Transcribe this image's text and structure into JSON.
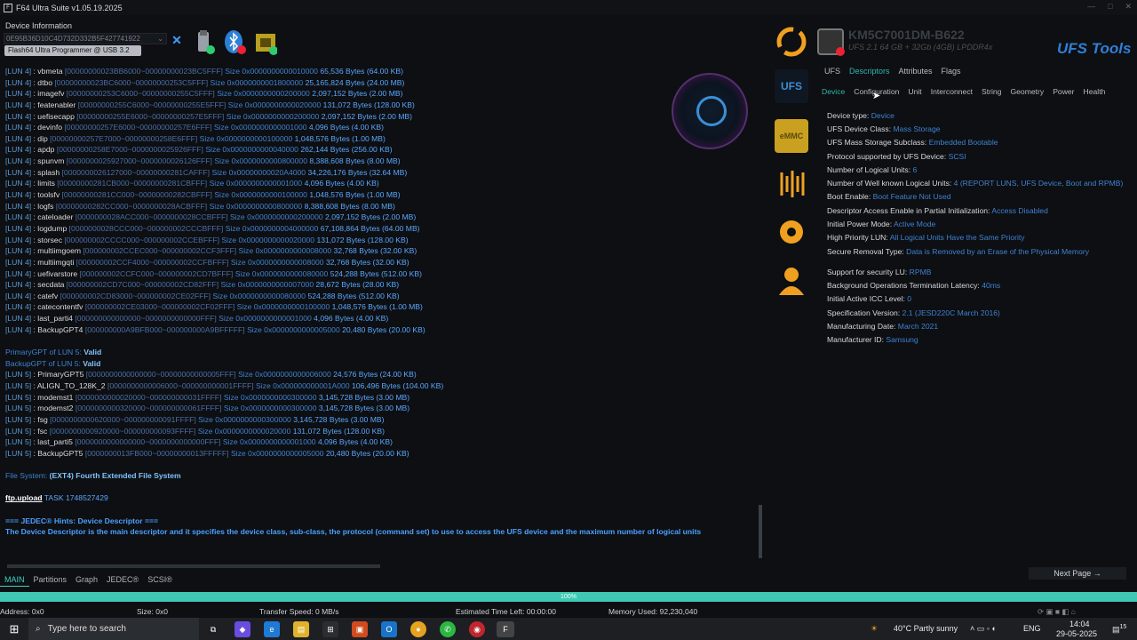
{
  "title": "F64 Ultra Suite v1.05.19.2025",
  "device_info_label": "Device Information",
  "serial": "0E95B36D10C4D732D332B5F427741922",
  "programmer": "Flash64 Ultra Programmer @ USB 3.2",
  "log_lines": [
    [
      [
        "lun",
        "[LUN 4]"
      ],
      [
        "nm",
        " : vbmeta "
      ],
      [
        "rng",
        "[00000000023BB6000~00000000023BC5FFF] "
      ],
      [
        "sz",
        "Size 0x0000000000010000 "
      ],
      [
        "by",
        "65,536 Bytes (64.00 KB)"
      ]
    ],
    [
      [
        "lun",
        "[LUN 4]"
      ],
      [
        "nm",
        " : dtbo "
      ],
      [
        "rng",
        "[00000000023BC6000~00000000253C5FFF] "
      ],
      [
        "sz",
        "Size 0x0000000001800000 "
      ],
      [
        "by",
        "25,165,824 Bytes (24.00 MB)"
      ]
    ],
    [
      [
        "lun",
        "[LUN 4]"
      ],
      [
        "nm",
        " : imagefv "
      ],
      [
        "rng",
        "[00000000253C6000~00000000255C5FFF] "
      ],
      [
        "sz",
        "Size 0x0000000000200000 "
      ],
      [
        "by",
        "2,097,152 Bytes (2.00 MB)"
      ]
    ],
    [
      [
        "lun",
        "[LUN 4]"
      ],
      [
        "nm",
        " : featenabler "
      ],
      [
        "rng",
        "[00000000255C6000~00000000255E5FFF] "
      ],
      [
        "sz",
        "Size 0x0000000000020000 "
      ],
      [
        "by",
        "131,072 Bytes (128.00 KB)"
      ]
    ],
    [
      [
        "lun",
        "[LUN 4]"
      ],
      [
        "nm",
        " : uefisecapp "
      ],
      [
        "rng",
        "[00000000255E6000~00000000257E5FFF] "
      ],
      [
        "sz",
        "Size 0x0000000000200000 "
      ],
      [
        "by",
        "2,097,152 Bytes (2.00 MB)"
      ]
    ],
    [
      [
        "lun",
        "[LUN 4]"
      ],
      [
        "nm",
        " : devinfo "
      ],
      [
        "rng",
        "[00000000257E6000~00000000257E6FFF] "
      ],
      [
        "sz",
        "Size 0x0000000000001000 "
      ],
      [
        "by",
        "4,096 Bytes (4.00 KB)"
      ]
    ],
    [
      [
        "lun",
        "[LUN 4]"
      ],
      [
        "nm",
        " : dip "
      ],
      [
        "rng",
        "[00000000257E7000~00000000258E6FFF] "
      ],
      [
        "sz",
        "Size 0x0000000000100000 "
      ],
      [
        "by",
        "1,048,576 Bytes (1.00 MB)"
      ]
    ],
    [
      [
        "lun",
        "[LUN 4]"
      ],
      [
        "nm",
        " : apdp "
      ],
      [
        "rng",
        "[00000000258E7000~0000000025926FFF] "
      ],
      [
        "sz",
        "Size 0x0000000000040000 "
      ],
      [
        "by",
        "262,144 Bytes (256.00 KB)"
      ]
    ],
    [
      [
        "lun",
        "[LUN 4]"
      ],
      [
        "nm",
        " : spunvm "
      ],
      [
        "rng",
        "[0000000025927000~0000000026126FFF] "
      ],
      [
        "sz",
        "Size 0x0000000000800000 "
      ],
      [
        "by",
        "8,388,608 Bytes (8.00 MB)"
      ]
    ],
    [
      [
        "lun",
        "[LUN 4]"
      ],
      [
        "nm",
        " : splash "
      ],
      [
        "rng",
        "[0000000026127000~00000000281CAFFF] "
      ],
      [
        "sz",
        "Size 0x00000000020A4000 "
      ],
      [
        "by",
        "34,226,176 Bytes (32.64 MB)"
      ]
    ],
    [
      [
        "lun",
        "[LUN 4]"
      ],
      [
        "nm",
        " : limits "
      ],
      [
        "rng",
        "[00000000281CB000~00000000281CBFFF] "
      ],
      [
        "sz",
        "Size 0x0000000000001000 "
      ],
      [
        "by",
        "4,096 Bytes (4.00 KB)"
      ]
    ],
    [
      [
        "lun",
        "[LUN 4]"
      ],
      [
        "nm",
        " : toolsfv "
      ],
      [
        "rng",
        "[00000000281CC000~00000000282CBFFF] "
      ],
      [
        "sz",
        "Size 0x0000000000100000 "
      ],
      [
        "by",
        "1,048,576 Bytes (1.00 MB)"
      ]
    ],
    [
      [
        "lun",
        "[LUN 4]"
      ],
      [
        "nm",
        " : logfs "
      ],
      [
        "rng",
        "[00000000282CC000~0000000028ACBFFF] "
      ],
      [
        "sz",
        "Size 0x0000000000800000 "
      ],
      [
        "by",
        "8,388,608 Bytes (8.00 MB)"
      ]
    ],
    [
      [
        "lun",
        "[LUN 4]"
      ],
      [
        "nm",
        " : cateloader "
      ],
      [
        "rng",
        "[0000000028ACC000~0000000028CCBFFF] "
      ],
      [
        "sz",
        "Size 0x0000000000200000 "
      ],
      [
        "by",
        "2,097,152 Bytes (2.00 MB)"
      ]
    ],
    [
      [
        "lun",
        "[LUN 4]"
      ],
      [
        "nm",
        " : logdump "
      ],
      [
        "rng",
        "[0000000028CCC000~000000002CCCBFFF] "
      ],
      [
        "sz",
        "Size 0x0000000004000000 "
      ],
      [
        "by",
        "67,108,864 Bytes (64.00 MB)"
      ]
    ],
    [
      [
        "lun",
        "[LUN 4]"
      ],
      [
        "nm",
        " : storsec "
      ],
      [
        "rng",
        "[000000002CCCC000~000000002CCEBFFF] "
      ],
      [
        "sz",
        "Size 0x0000000000020000 "
      ],
      [
        "by",
        "131,072 Bytes (128.00 KB)"
      ]
    ],
    [
      [
        "lun",
        "[LUN 4]"
      ],
      [
        "nm",
        " : multiimgoem "
      ],
      [
        "rng",
        "[000000002CCEC000~000000002CCF3FFF] "
      ],
      [
        "sz",
        "Size 0x0000000000008000 "
      ],
      [
        "by",
        "32,768 Bytes (32.00 KB)"
      ]
    ],
    [
      [
        "lun",
        "[LUN 4]"
      ],
      [
        "nm",
        " : multiimgqti "
      ],
      [
        "rng",
        "[000000002CCF4000~000000002CCFBFFF] "
      ],
      [
        "sz",
        "Size 0x0000000000008000 "
      ],
      [
        "by",
        "32,768 Bytes (32.00 KB)"
      ]
    ],
    [
      [
        "lun",
        "[LUN 4]"
      ],
      [
        "nm",
        " : uefivarstore "
      ],
      [
        "rng",
        "[000000002CCFC000~000000002CD7BFFF] "
      ],
      [
        "sz",
        "Size 0x0000000000080000 "
      ],
      [
        "by",
        "524,288 Bytes (512.00 KB)"
      ]
    ],
    [
      [
        "lun",
        "[LUN 4]"
      ],
      [
        "nm",
        " : secdata "
      ],
      [
        "rng",
        "[000000002CD7C000~000000002CD82FFF] "
      ],
      [
        "sz",
        "Size 0x0000000000007000 "
      ],
      [
        "by",
        "28,672 Bytes (28.00 KB)"
      ]
    ],
    [
      [
        "lun",
        "[LUN 4]"
      ],
      [
        "nm",
        " : catefv "
      ],
      [
        "rng",
        "[000000002CD83000~000000002CE02FFF] "
      ],
      [
        "sz",
        "Size 0x0000000000080000 "
      ],
      [
        "by",
        "524,288 Bytes (512.00 KB)"
      ]
    ],
    [
      [
        "lun",
        "[LUN 4]"
      ],
      [
        "nm",
        " : catecontentfv "
      ],
      [
        "rng",
        "[000000002CE03000~000000002CF02FFF] "
      ],
      [
        "sz",
        "Size 0x0000000000100000 "
      ],
      [
        "by",
        "1,048,576 Bytes (1.00 MB)"
      ]
    ],
    [
      [
        "lun",
        "[LUN 4]"
      ],
      [
        "nm",
        " : last_parti4 "
      ],
      [
        "rng",
        "[000000000000000~0000000000000FFF] "
      ],
      [
        "sz",
        "Size 0x0000000000001000 "
      ],
      [
        "by",
        "4,096 Bytes (4.00 KB)"
      ]
    ],
    [
      [
        "lun",
        "[LUN 4]"
      ],
      [
        "nm",
        " : BackupGPT4 "
      ],
      [
        "rng",
        "[000000000A9BFB000~000000000A9BFFFFF] "
      ],
      [
        "sz",
        "Size 0x0000000000005000 "
      ],
      [
        "by",
        "20,480 Bytes (20.00 KB)"
      ]
    ],
    [],
    [
      [
        "gpt",
        "PrimaryGPT of LUN 5: "
      ],
      [
        "valid",
        "Valid"
      ]
    ],
    [
      [
        "gpt",
        "BackupGPT of LUN 5: "
      ],
      [
        "valid",
        "Valid"
      ]
    ],
    [
      [
        "lun",
        "[LUN 5]"
      ],
      [
        "nm",
        " : PrimaryGPT5 "
      ],
      [
        "rng",
        "[0000000000000000~00000000000005FFF] "
      ],
      [
        "sz",
        "Size 0x0000000000006000 "
      ],
      [
        "by",
        "24,576 Bytes (24.00 KB)"
      ]
    ],
    [
      [
        "lun",
        "[LUN 5]"
      ],
      [
        "nm",
        " : ALIGN_TO_128K_2 "
      ],
      [
        "rng",
        "[0000000000006000~000000000001FFFF] "
      ],
      [
        "sz",
        "Size 0x000000000001A000 "
      ],
      [
        "by",
        "106,496 Bytes (104.00 KB)"
      ]
    ],
    [
      [
        "lun",
        "[LUN 5]"
      ],
      [
        "nm",
        " : modemst1 "
      ],
      [
        "rng",
        "[0000000000020000~000000000031FFFF] "
      ],
      [
        "sz",
        "Size 0x0000000000300000 "
      ],
      [
        "by",
        "3,145,728 Bytes (3.00 MB)"
      ]
    ],
    [
      [
        "lun",
        "[LUN 5]"
      ],
      [
        "nm",
        " : modemst2 "
      ],
      [
        "rng",
        "[0000000000320000~000000000061FFFF] "
      ],
      [
        "sz",
        "Size 0x0000000000300000 "
      ],
      [
        "by",
        "3,145,728 Bytes (3.00 MB)"
      ]
    ],
    [
      [
        "lun",
        "[LUN 5]"
      ],
      [
        "nm",
        " : fsg "
      ],
      [
        "rng",
        "[0000000000620000~000000000091FFFF] "
      ],
      [
        "sz",
        "Size 0x0000000000300000 "
      ],
      [
        "by",
        "3,145,728 Bytes (3.00 MB)"
      ]
    ],
    [
      [
        "lun",
        "[LUN 5]"
      ],
      [
        "nm",
        " : fsc "
      ],
      [
        "rng",
        "[0000000000920000~000000000093FFFF] "
      ],
      [
        "sz",
        "Size 0x0000000000020000 "
      ],
      [
        "by",
        "131,072 Bytes (128.00 KB)"
      ]
    ],
    [
      [
        "lun",
        "[LUN 5]"
      ],
      [
        "nm",
        " : last_parti5 "
      ],
      [
        "rng",
        "[0000000000000000~0000000000000FFF] "
      ],
      [
        "sz",
        "Size 0x0000000000001000 "
      ],
      [
        "by",
        "4,096 Bytes (4.00 KB)"
      ]
    ],
    [
      [
        "lun",
        "[LUN 5]"
      ],
      [
        "nm",
        " : BackupGPT5 "
      ],
      [
        "rng",
        "[0000000013FB000~00000000013FFFFF] "
      ],
      [
        "sz",
        "Size 0x0000000000005000 "
      ],
      [
        "by",
        "20,480 Bytes (20.00 KB)"
      ]
    ],
    [],
    [
      [
        "fs",
        "File System: "
      ],
      [
        "fsv",
        "(EXT4) Fourth Extended File System"
      ]
    ],
    [],
    [
      [
        "ftp",
        "ftp.upload"
      ],
      [
        "task",
        " TASK 1748527429"
      ]
    ],
    [],
    [
      [
        "hint",
        "=== JEDEC® Hints: Device Descriptor ==="
      ]
    ],
    [
      [
        "hint",
        "The Device Descriptor is the main descriptor and it specifies the device class, sub-class, the protocol (command set) to use to access the UFS device and the maximum number of logical units"
      ]
    ]
  ],
  "bottom_tabs": [
    "MAIN",
    "Partitions",
    "Graph",
    "JEDEC®",
    "SCSI®"
  ],
  "progress": {
    "value": 100,
    "label": "100%"
  },
  "status": {
    "address": "Address: 0x0",
    "size": "Size: 0x0",
    "speed": "Transfer Speed: 0 MB/s",
    "eta": "Estimated Time Left: 00:00:00",
    "memory": "Memory Used: 92,230,040"
  },
  "side_icons": [
    "refresh-icon",
    "ufs-icon",
    "emmc-icon",
    "jtag-icon",
    "settings-icon",
    "support-icon"
  ],
  "side_labels": {
    "ufs": "UFS",
    "emmc": "eMMC"
  },
  "model": "KM5C7001DM-B622",
  "model_sub": "UFS 2.1   64 GB + 32Gb (4GB) LPDDR4x",
  "brand": "UFS Tools",
  "desc_tabs": [
    "UFS",
    "Descriptors",
    "Attributes",
    "Flags"
  ],
  "sub_tabs": [
    "Device",
    "Configuration",
    "Unit",
    "Interconnect",
    "String",
    "Geometry",
    "Power",
    "Health"
  ],
  "properties": [
    {
      "label": "Device type:",
      "value": "Device"
    },
    {
      "label": "UFS Device Class:",
      "value": "Mass Storage"
    },
    {
      "label": "UFS Mass Storage Subclass:",
      "value": "Embedded Bootable"
    },
    {
      "label": "Protocol supported by UFS Device:",
      "value": "SCSI"
    },
    {
      "label": "Number of Logical Units:",
      "value": "6"
    },
    {
      "label": "Number of Well known Logical Units:",
      "value": "4 (REPORT LUNS, UFS Device, Boot and RPMB)"
    },
    {
      "label": "Boot Enable:",
      "value": "Boot Feature Not Used"
    },
    {
      "label": "Descriptor Access Enable in Partial Initialization:",
      "value": "Access Disabled"
    },
    {
      "label": "Initial Power Mode:",
      "value": "Active Mode"
    },
    {
      "label": "High Priority LUN:",
      "value": "All Logical Units Have the Same Priority"
    },
    {
      "label": "Secure Removal Type:",
      "value": "Data is Removed by an Erase of the Physical Memory"
    },
    {
      "label": "Support for security LU:",
      "value": "RPMB"
    },
    {
      "label": "Background Operations Termination Latency:",
      "value": "40ms"
    },
    {
      "label": "Initial Active ICC Level:",
      "value": "0"
    },
    {
      "label": "Specification Version:",
      "value": "2.1 (JESD220C March 2016)"
    },
    {
      "label": "Manufacturing Date:",
      "value": "March 2021"
    },
    {
      "label": "Manufacturer ID:",
      "value": "Samsung"
    }
  ],
  "next_page": "Next Page →",
  "taskbar": {
    "search_placeholder": "Type here to search",
    "weather": "40°C  Partly sunny",
    "lang": "ENG",
    "time": "14:04",
    "date": "29-05-2025",
    "notif": "15"
  },
  "colors": {
    "accent": "#3fc9b4",
    "value": "#3f82d1",
    "brand": "#2f7fd6"
  }
}
